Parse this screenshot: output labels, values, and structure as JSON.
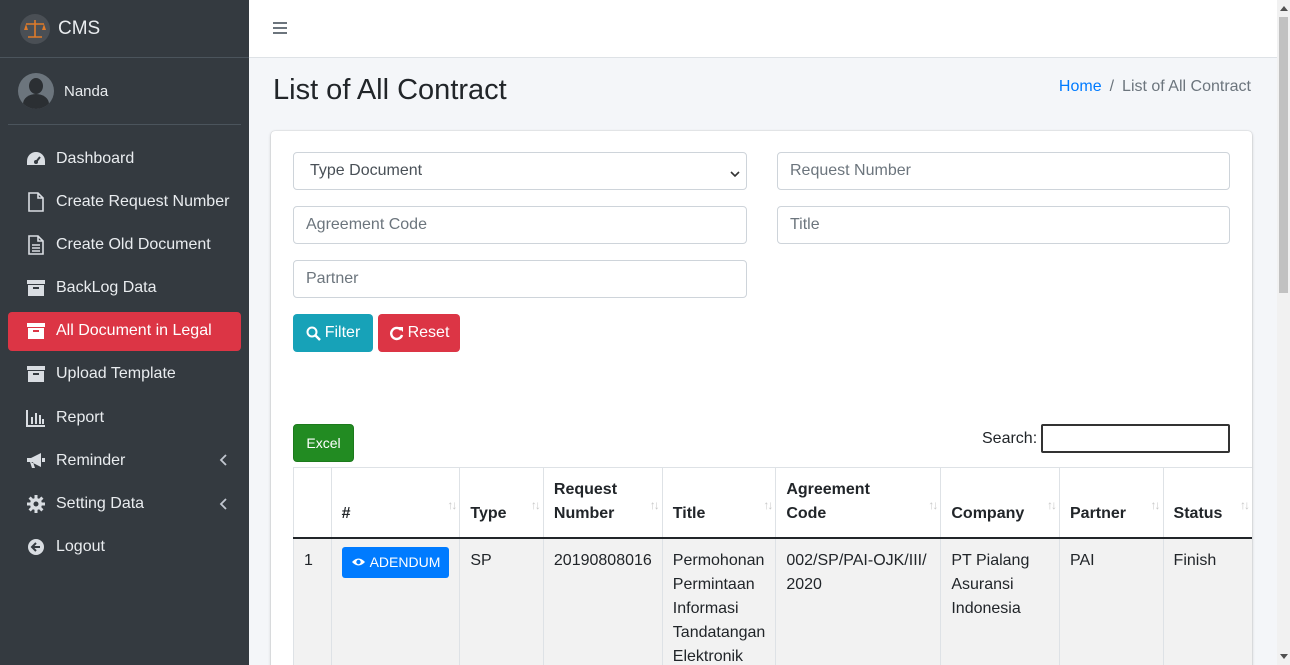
{
  "brand": {
    "name": "CMS"
  },
  "user": {
    "name": "Nanda"
  },
  "sidebar": {
    "items": [
      {
        "label": "Dashboard",
        "icon": "tachometer-icon"
      },
      {
        "label": "Create Request Number",
        "icon": "file-icon"
      },
      {
        "label": "Create Old Document",
        "icon": "file-text-icon"
      },
      {
        "label": "BackLog Data",
        "icon": "archive-icon"
      },
      {
        "label": "All Document in Legal",
        "icon": "archive-icon",
        "active": true
      },
      {
        "label": "Upload Template",
        "icon": "archive-icon"
      },
      {
        "label": "Report",
        "icon": "bar-chart-icon"
      },
      {
        "label": "Reminder",
        "icon": "bullhorn-icon",
        "has_submenu": true
      },
      {
        "label": "Setting Data",
        "icon": "gear-icon",
        "has_submenu": true
      },
      {
        "label": "Logout",
        "icon": "logout-icon"
      }
    ]
  },
  "page": {
    "title": "List of All Contract",
    "breadcrumb": {
      "home": "Home",
      "current": "List of All Contract"
    }
  },
  "filters": {
    "type_document": "Type Document",
    "request_number_placeholder": "Request Number",
    "agreement_code_placeholder": "Agreement Code",
    "title_placeholder": "Title",
    "partner_placeholder": "Partner",
    "filter_label": "Filter",
    "reset_label": "Reset"
  },
  "table_tools": {
    "excel_label": "Excel",
    "search_label": "Search:"
  },
  "table": {
    "headers": [
      "#",
      "Type",
      "Request Number",
      "Title",
      "Agreement Code",
      "Company",
      "Partner",
      "Status"
    ],
    "rows": [
      {
        "no": "1",
        "action": "ADENDUM",
        "type": "SP",
        "request_number": "20190808016",
        "title": "Permohonan Permintaan Informasi Tandatangan Elektronik",
        "agreement_code": "002/SP/PAI-OJK/III/2020",
        "company": "PT Pialang Asuransi Indonesia",
        "partner": "PAI",
        "status": "Finish"
      }
    ]
  },
  "colors": {
    "sidebar": "#343a40",
    "active": "#dc3545",
    "filter": "#17a2b8",
    "excel": "#228b22",
    "primary": "#007bff"
  }
}
